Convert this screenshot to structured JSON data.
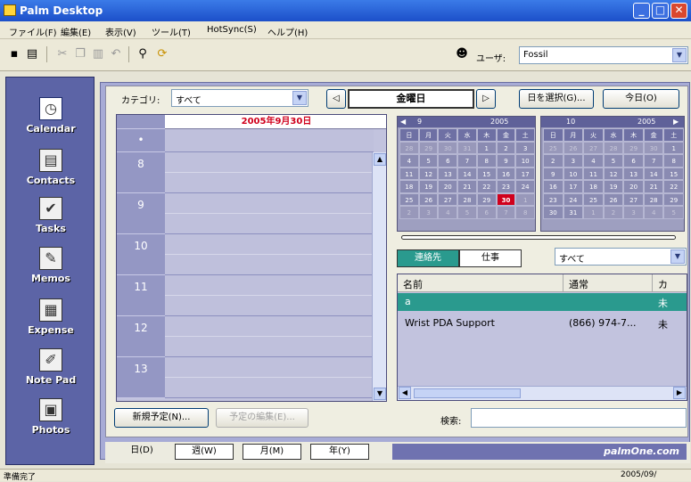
{
  "window": {
    "title": "Palm Desktop",
    "controls": [
      "_",
      "□",
      "✕"
    ]
  },
  "menu": [
    "ファイル(F)",
    "編集(E)",
    "表示(V)",
    "ツール(T)",
    "HotSync(S)",
    "ヘルプ(H)"
  ],
  "toolbar": {
    "user_label": "ユーザ:",
    "user_value": "Fossil",
    "icons": [
      "save-icon",
      "print-icon",
      "cut-icon",
      "copy-icon",
      "paste-icon",
      "undo-icon",
      "find-icon",
      "hotsync-icon",
      "user-icon"
    ]
  },
  "sidebar": {
    "items": [
      {
        "label": "Calendar",
        "glyph": "◷"
      },
      {
        "label": "Contacts",
        "glyph": "▤"
      },
      {
        "label": "Tasks",
        "glyph": "✔"
      },
      {
        "label": "Memos",
        "glyph": "✎"
      },
      {
        "label": "Expense",
        "glyph": "▦"
      },
      {
        "label": "Note Pad",
        "glyph": "✐"
      },
      {
        "label": "Photos",
        "glyph": "▣"
      }
    ]
  },
  "header": {
    "category_label": "カテゴリ:",
    "category_value": "すべて",
    "prev": "◁",
    "day_name": "金曜日",
    "next": "▷",
    "select_day_btn": "日を選択(G)...",
    "today_btn": "今日(O)"
  },
  "day": {
    "date_header": "2005年9月30日",
    "top_marker": "•",
    "hours": [
      "8",
      "9",
      "10",
      "11",
      "12",
      "13"
    ]
  },
  "calendars": [
    {
      "month": "9",
      "year": "2005",
      "weekdays": [
        "日",
        "月",
        "火",
        "水",
        "木",
        "金",
        "土"
      ],
      "weeks": [
        [
          "28",
          "29",
          "30",
          "31",
          "1",
          "2",
          "3"
        ],
        [
          "4",
          "5",
          "6",
          "7",
          "8",
          "9",
          "10"
        ],
        [
          "11",
          "12",
          "13",
          "14",
          "15",
          "16",
          "17"
        ],
        [
          "18",
          "19",
          "20",
          "21",
          "22",
          "23",
          "24"
        ],
        [
          "25",
          "26",
          "27",
          "28",
          "29",
          "30",
          "1"
        ],
        [
          "2",
          "3",
          "4",
          "5",
          "6",
          "7",
          "8"
        ]
      ]
    },
    {
      "month": "10",
      "year": "2005",
      "weekdays": [
        "日",
        "月",
        "火",
        "水",
        "木",
        "金",
        "土"
      ],
      "weeks": [
        [
          "25",
          "26",
          "27",
          "28",
          "29",
          "30",
          "1"
        ],
        [
          "2",
          "3",
          "4",
          "5",
          "6",
          "7",
          "8"
        ],
        [
          "9",
          "10",
          "11",
          "12",
          "13",
          "14",
          "15"
        ],
        [
          "16",
          "17",
          "18",
          "19",
          "20",
          "21",
          "22"
        ],
        [
          "23",
          "24",
          "25",
          "26",
          "27",
          "28",
          "29"
        ],
        [
          "30",
          "31",
          "1",
          "2",
          "3",
          "4",
          "5"
        ]
      ]
    }
  ],
  "contacts": {
    "tab1": "連絡先",
    "tab2": "仕事",
    "filter": "すべて",
    "columns": [
      "名前",
      "通常",
      "カ"
    ],
    "rows": [
      {
        "name": "a",
        "phone": "",
        "cat": "未"
      },
      {
        "name": "Wrist PDA Support",
        "phone": "(866) 974-7...",
        "cat": "未"
      }
    ]
  },
  "actions": {
    "new_event": "新規予定(N)...",
    "edit_event": "予定の編集(E)...",
    "search_label": "検索:"
  },
  "views": [
    "日(D)",
    "週(W)",
    "月(M)",
    "年(Y)"
  ],
  "brand": "palmOne.com",
  "status": {
    "left": "準備完了",
    "right": "2005/09/"
  }
}
